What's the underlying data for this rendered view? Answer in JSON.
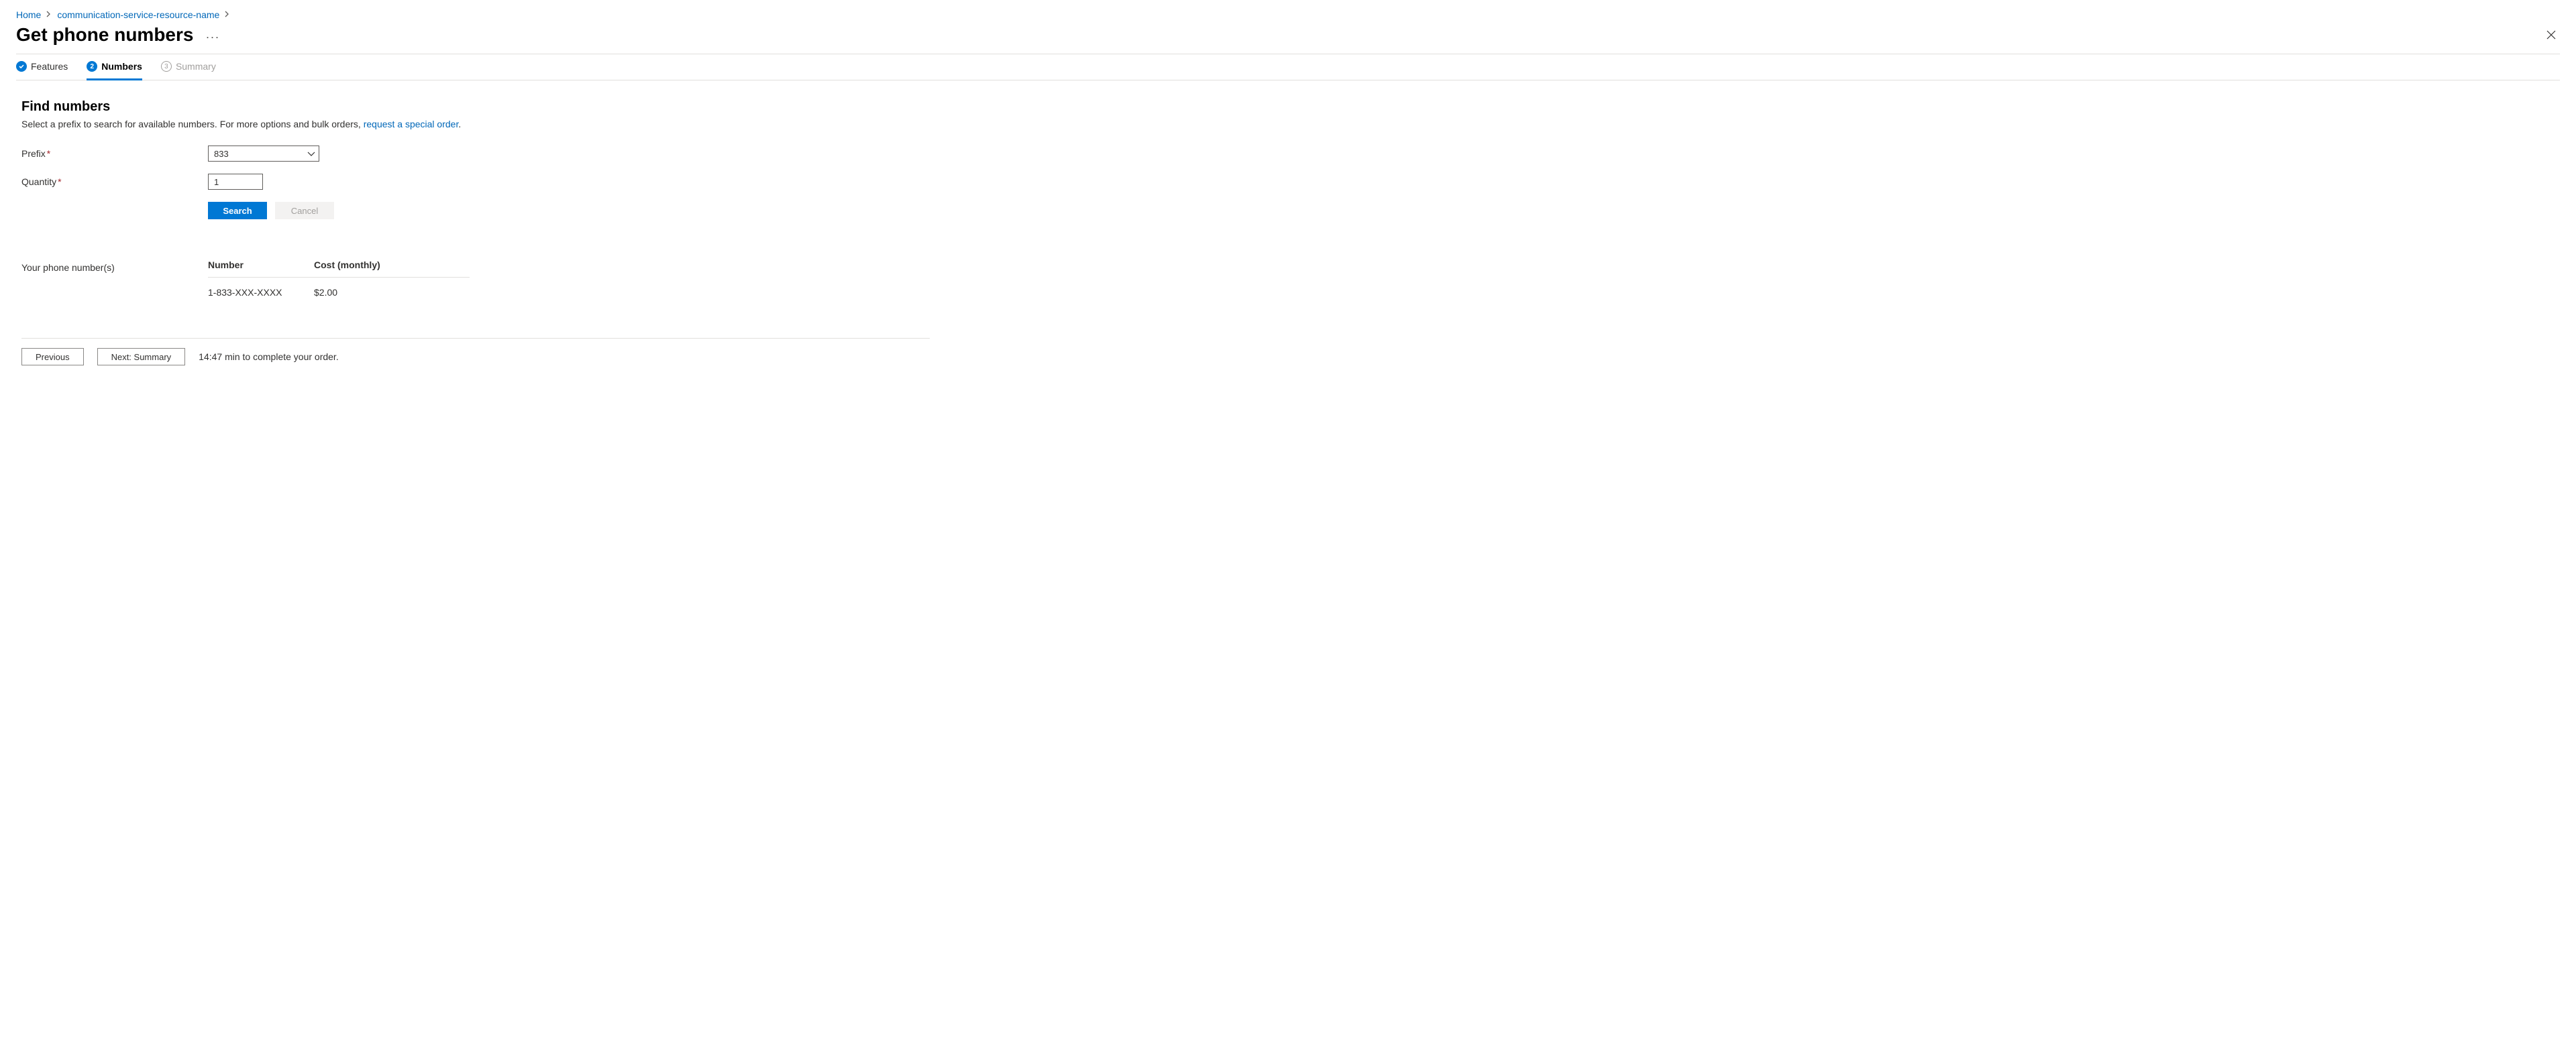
{
  "breadcrumb": {
    "items": [
      "Home",
      "communication-service-resource-name"
    ]
  },
  "header": {
    "title": "Get phone numbers"
  },
  "tabs": [
    {
      "label": "Features",
      "state": "done"
    },
    {
      "label": "Numbers",
      "state": "current"
    },
    {
      "label": "Summary",
      "state": "upcoming",
      "num": "3"
    }
  ],
  "find": {
    "title": "Find numbers",
    "desc_prefix": "Select a prefix to search for available numbers. For more options and bulk orders, ",
    "link_text": "request a special order",
    "desc_suffix": ".",
    "prefix_label": "Prefix",
    "prefix_value": "833",
    "quantity_label": "Quantity",
    "quantity_value": "1",
    "search_label": "Search",
    "cancel_label": "Cancel"
  },
  "results": {
    "label": "Your phone number(s)",
    "columns": {
      "number": "Number",
      "cost": "Cost (monthly)"
    },
    "rows": [
      {
        "number": "1-833-XXX-XXXX",
        "cost": "$2.00"
      }
    ]
  },
  "footer": {
    "previous": "Previous",
    "next": "Next: Summary",
    "hint": "14:47 min to complete your order."
  }
}
